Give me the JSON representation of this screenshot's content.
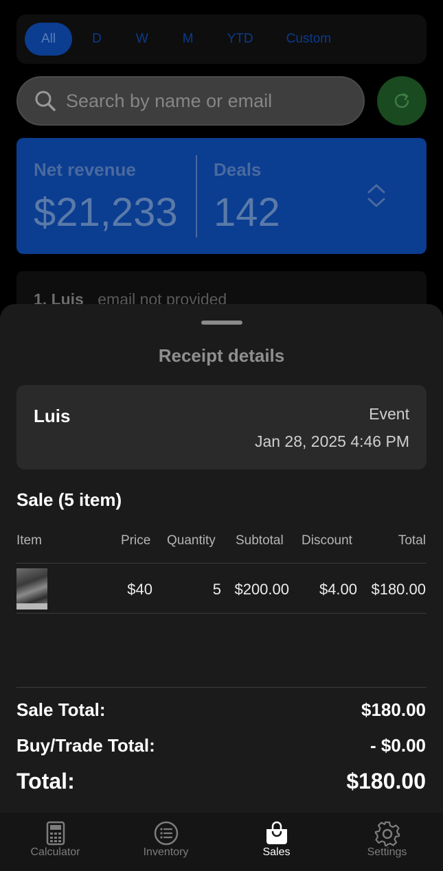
{
  "filters": {
    "chips": [
      "All",
      "D",
      "W",
      "M",
      "YTD",
      "Custom"
    ],
    "active": "All"
  },
  "search": {
    "placeholder": "Search by name or email"
  },
  "stats": {
    "net_revenue_label": "Net revenue",
    "net_revenue_value": "$21,233",
    "deals_label": "Deals",
    "deals_value": "142"
  },
  "list": {
    "first_item": {
      "name": "1. Luis",
      "email": "email not provided"
    }
  },
  "receipt": {
    "title": "Receipt details",
    "customer_name": "Luis",
    "event_label": "Event",
    "date": "Jan 28, 2025 4:46 PM",
    "sale_heading": "Sale (5 item)",
    "columns": [
      "Item",
      "Price",
      "Quantity",
      "Subtotal",
      "Discount",
      "Total"
    ],
    "rows": [
      {
        "price": "$40",
        "quantity": "5",
        "subtotal": "$200.00",
        "discount": "$4.00",
        "total": "$180.00"
      }
    ],
    "sale_total_label": "Sale Total:",
    "sale_total_value": "$180.00",
    "buy_trade_label": "Buy/Trade Total:",
    "buy_trade_value": "- $0.00",
    "total_label": "Total:",
    "total_value": "$180.00"
  },
  "tabs": [
    {
      "label": "Calculator",
      "icon": "calculator-icon"
    },
    {
      "label": "Inventory",
      "icon": "list-icon"
    },
    {
      "label": "Sales",
      "icon": "shopping-bag-icon",
      "active": true
    },
    {
      "label": "Settings",
      "icon": "gear-icon"
    }
  ],
  "colors": {
    "accent_blue": "#0b3d91",
    "refresh_green": "#1a4a1f",
    "sheet_bg": "#1b1b1b"
  }
}
